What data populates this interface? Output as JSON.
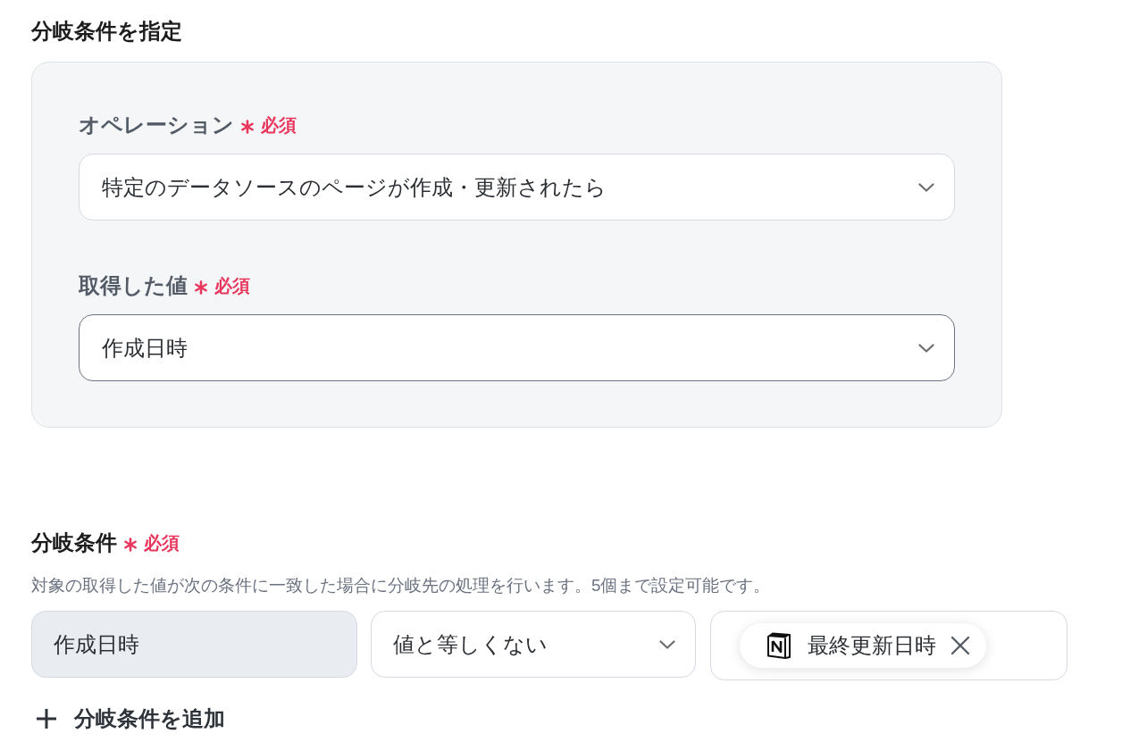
{
  "condition_settings": {
    "title": "分岐条件を指定",
    "fields": [
      {
        "label": "オペレーション",
        "required": true,
        "required_label": "必須",
        "value": "特定のデータソースのページが作成・更新されたら",
        "focused": false
      },
      {
        "label": "取得した値",
        "required": true,
        "required_label": "必須",
        "value": "作成日時",
        "focused": true
      }
    ]
  },
  "branch_conditions": {
    "label": "分岐条件",
    "required": true,
    "required_label": "必須",
    "description": "対象の取得した値が次の条件に一致した場合に分岐先の処理を行います。5個まで設定可能です。",
    "rows": [
      {
        "cells": [
          {
            "kind": "readonly",
            "value": "作成日時"
          },
          {
            "kind": "select",
            "value": "値と等しくない"
          },
          {
            "kind": "tokens",
            "tokens": [
              {
                "label": "最終更新日時"
              }
            ]
          }
        ]
      }
    ],
    "add_button": "分岐条件を追加"
  }
}
